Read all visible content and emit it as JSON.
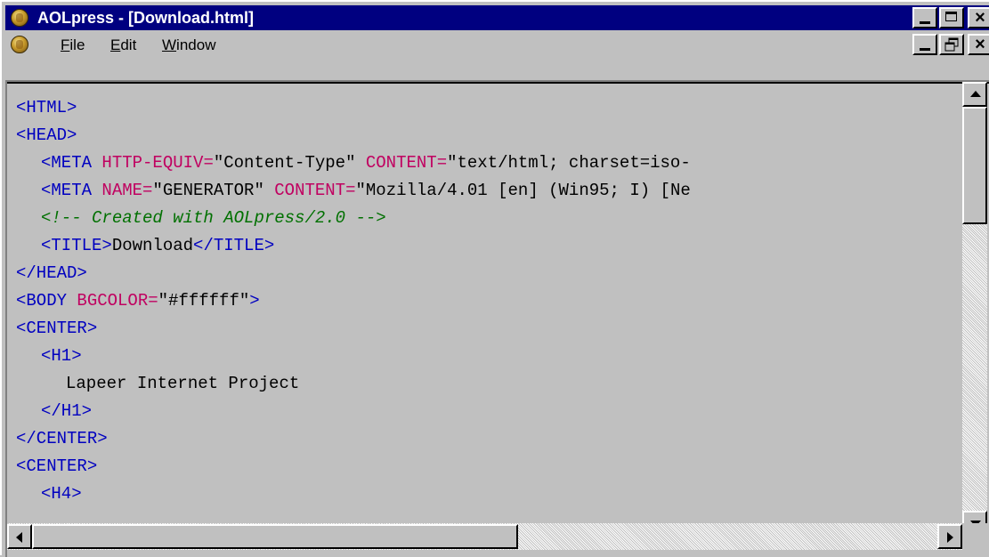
{
  "window": {
    "title": "AOLpress - [Download.html]",
    "icon": "aolpress-app-icon",
    "controls": {
      "minimize": "minimize-icon",
      "maximize": "maximize-icon",
      "close": "×"
    }
  },
  "menubar": {
    "icon": "aolpress-doc-icon",
    "items": [
      {
        "mnemonic": "F",
        "rest": "ile"
      },
      {
        "mnemonic": "E",
        "rest": "dit"
      },
      {
        "mnemonic": "W",
        "rest": "indow"
      }
    ],
    "controls": {
      "minimize": "minimize-icon",
      "restore": "restore-icon",
      "close": "×"
    }
  },
  "editor": {
    "colors": {
      "tag": "#0000c0",
      "attribute": "#c00060",
      "comment": "#007000",
      "text": "#000000",
      "background": "#c0c0c0"
    },
    "lines": [
      {
        "l0": "<HTML>"
      },
      {
        "l1": "<HEAD>"
      },
      {
        "a": "<META ",
        "b": "HTTP-EQUIV=",
        "c": "\"Content-Type\" ",
        "d": "CONTENT=",
        "e": "\"text/html; charset=iso-"
      },
      {
        "a": "<META ",
        "b": "NAME=",
        "c": "\"GENERATOR\" ",
        "d": "CONTENT=",
        "e": "\"Mozilla/4.01 [en] (Win95; I) [Ne"
      },
      {
        "comment": "<!-- Created with AOLpress/2.0 -->"
      },
      {
        "open": "<TITLE>",
        "text": "Download",
        "close": "</TITLE>"
      },
      {
        "l0": "</HEAD>"
      },
      {
        "a": "<BODY ",
        "b": "BGCOLOR=",
        "c": "\"#ffffff\"",
        "d": ">"
      },
      {
        "l0": "<CENTER>"
      },
      {
        "l1": "<H1>"
      },
      {
        "text": "Lapeer Internet Project"
      },
      {
        "l1": "</H1>"
      },
      {
        "l0": "</CENTER>"
      },
      {
        "l0": "<CENTER>"
      },
      {
        "l1": "<H4>"
      }
    ]
  },
  "scrollbars": {
    "vertical": {
      "up": "scroll-up-arrow",
      "down": "scroll-down-arrow",
      "position": 0.0
    },
    "horizontal": {
      "left": "scroll-left-arrow",
      "right": "scroll-right-arrow",
      "position": 0.0
    }
  }
}
